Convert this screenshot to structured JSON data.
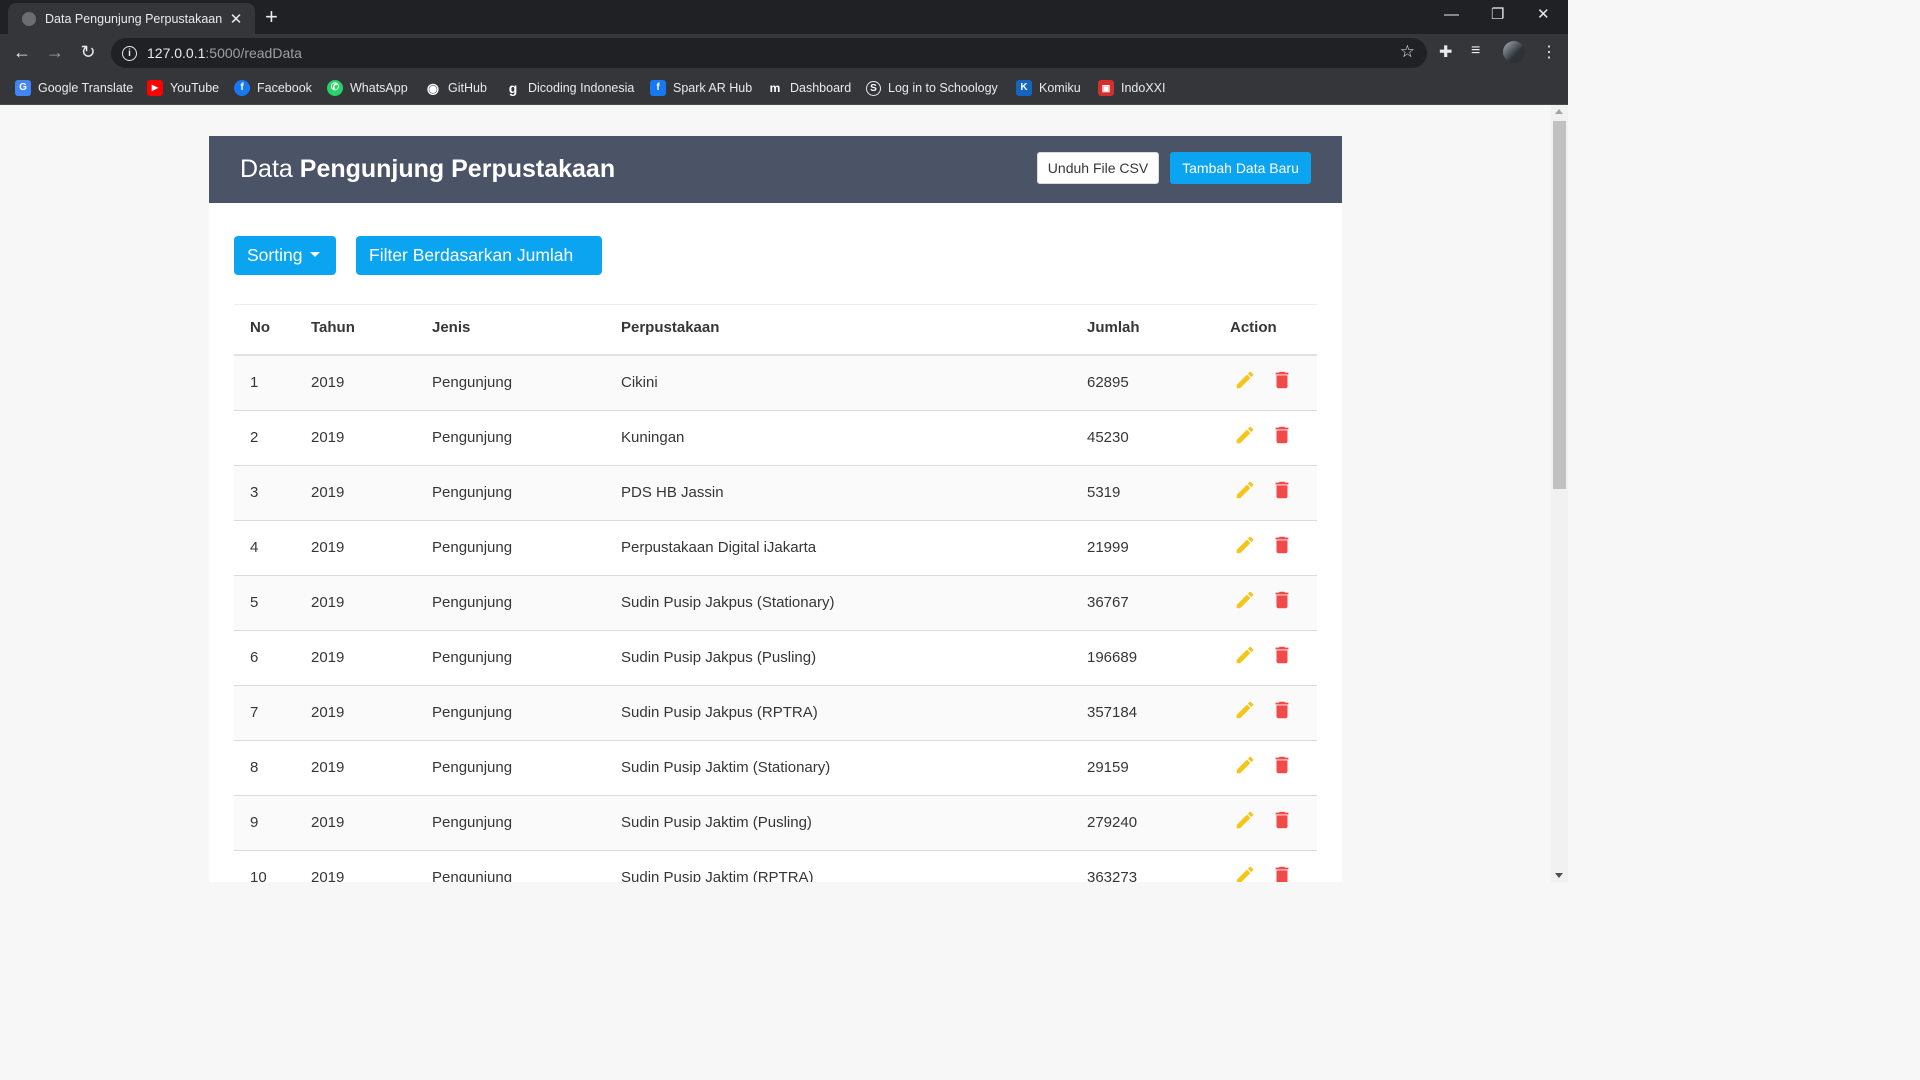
{
  "browser": {
    "tab_title": "Data Pengunjung Perpustakaan",
    "tab_close": "✕",
    "new_tab": "+",
    "url_host": "127.0.0.1",
    "url_path": ":5000/readData",
    "bookmarks": [
      {
        "label": "Google Translate",
        "icon": "google-translate-icon",
        "color": "#4285f4",
        "glyph": "G"
      },
      {
        "label": "YouTube",
        "icon": "youtube-icon",
        "color": "#ff0000",
        "glyph": "▶"
      },
      {
        "label": "Facebook",
        "icon": "facebook-icon",
        "color": "#1877f2",
        "glyph": "f"
      },
      {
        "label": "WhatsApp",
        "icon": "whatsapp-icon",
        "color": "#25d366",
        "glyph": "✆"
      },
      {
        "label": "GitHub",
        "icon": "github-icon",
        "color": "#35363a",
        "glyph": "◉"
      },
      {
        "label": "Dicoding Indonesia",
        "icon": "dicoding-icon",
        "color": "#35363a",
        "glyph": "g"
      },
      {
        "label": "Spark AR Hub",
        "icon": "facebook-icon",
        "color": "#1877f2",
        "glyph": "f"
      },
      {
        "label": "Dashboard",
        "icon": "dashboard-icon",
        "color": "#35363a",
        "glyph": "m"
      },
      {
        "label": "Log in to Schoology",
        "icon": "schoology-icon",
        "color": "#35363a",
        "glyph": "S"
      },
      {
        "label": "Komiku",
        "icon": "komiku-icon",
        "color": "#1565c0",
        "glyph": "K"
      },
      {
        "label": "IndoXXI",
        "icon": "indoxxi-icon",
        "color": "#d32f2f",
        "glyph": "▣"
      }
    ]
  },
  "header": {
    "title_light": "Data",
    "title_bold": "Pengunjung Perpustakaan",
    "download_label": "Unduh File CSV",
    "add_label": "Tambah Data Baru"
  },
  "controls": {
    "sorting_label": "Sorting",
    "filter_label": "Filter Berdasarkan Jumlah"
  },
  "table": {
    "columns": [
      "No",
      "Tahun",
      "Jenis",
      "Perpustakaan",
      "Jumlah",
      "Action"
    ],
    "rows": [
      {
        "no": "1",
        "tahun": "2019",
        "jenis": "Pengunjung",
        "perpustakaan": "Cikini",
        "jumlah": "62895"
      },
      {
        "no": "2",
        "tahun": "2019",
        "jenis": "Pengunjung",
        "perpustakaan": "Kuningan",
        "jumlah": "45230"
      },
      {
        "no": "3",
        "tahun": "2019",
        "jenis": "Pengunjung",
        "perpustakaan": "PDS HB Jassin",
        "jumlah": "5319"
      },
      {
        "no": "4",
        "tahun": "2019",
        "jenis": "Pengunjung",
        "perpustakaan": "Perpustakaan Digital iJakarta",
        "jumlah": "21999"
      },
      {
        "no": "5",
        "tahun": "2019",
        "jenis": "Pengunjung",
        "perpustakaan": "Sudin Pusip Jakpus (Stationary)",
        "jumlah": "36767"
      },
      {
        "no": "6",
        "tahun": "2019",
        "jenis": "Pengunjung",
        "perpustakaan": "Sudin Pusip Jakpus (Pusling)",
        "jumlah": "196689"
      },
      {
        "no": "7",
        "tahun": "2019",
        "jenis": "Pengunjung",
        "perpustakaan": "Sudin Pusip Jakpus (RPTRA)",
        "jumlah": "357184"
      },
      {
        "no": "8",
        "tahun": "2019",
        "jenis": "Pengunjung",
        "perpustakaan": "Sudin Pusip Jaktim (Stationary)",
        "jumlah": "29159"
      },
      {
        "no": "9",
        "tahun": "2019",
        "jenis": "Pengunjung",
        "perpustakaan": "Sudin Pusip Jaktim (Pusling)",
        "jumlah": "279240"
      },
      {
        "no": "10",
        "tahun": "2019",
        "jenis": "Pengunjung",
        "perpustakaan": "Sudin Pusip Jaktim (RPTRA)",
        "jumlah": "363273"
      }
    ]
  },
  "colors": {
    "header_bg": "#4b5366",
    "accent": "#0aa4f0",
    "edit": "#f5c518",
    "delete": "#f14a4a"
  }
}
